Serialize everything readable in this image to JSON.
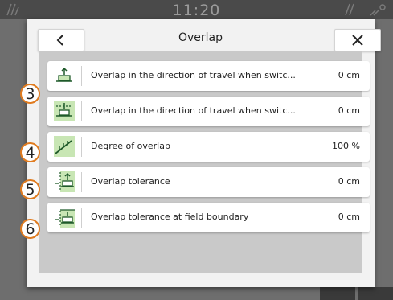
{
  "statusbar": {
    "time": "11:20"
  },
  "dialog": {
    "title": "Overlap",
    "back_icon": "chevron-left-icon",
    "close_icon": "close-icon"
  },
  "rows": [
    {
      "label": "Overlap in the direction of travel when switc...",
      "value": "0 cm",
      "icon": "overlap-travel-on-icon"
    },
    {
      "label": "Overlap in the direction of travel when switc...",
      "value": "0 cm",
      "icon": "overlap-travel-off-icon"
    },
    {
      "label": "Degree of overlap",
      "value": "100 %",
      "icon": "degree-of-overlap-icon"
    },
    {
      "label": "Overlap tolerance",
      "value": "0 cm",
      "icon": "overlap-tolerance-icon"
    },
    {
      "label": "Overlap tolerance at field boundary",
      "value": "0 cm",
      "icon": "field-boundary-tolerance-icon"
    }
  ],
  "callouts": [
    "3",
    "4",
    "5",
    "6"
  ],
  "colors": {
    "callout_border": "#e07b1f",
    "icon_green": "#c8e6b4",
    "icon_dark": "#1f5a2a"
  }
}
